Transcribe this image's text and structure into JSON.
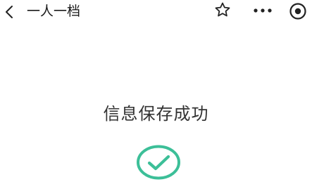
{
  "header": {
    "title": "一人一档",
    "back_icon": "chevron-left-icon",
    "actions": [
      {
        "icon": "star-icon"
      },
      {
        "icon": "more-dots-icon"
      },
      {
        "icon": "record-target-icon"
      }
    ]
  },
  "main": {
    "message": "信息保存成功",
    "status_icon": "check-circle-icon"
  },
  "colors": {
    "accent": "#3cbf98",
    "text": "#333333",
    "icon": "#222222",
    "background": "#ffffff"
  }
}
